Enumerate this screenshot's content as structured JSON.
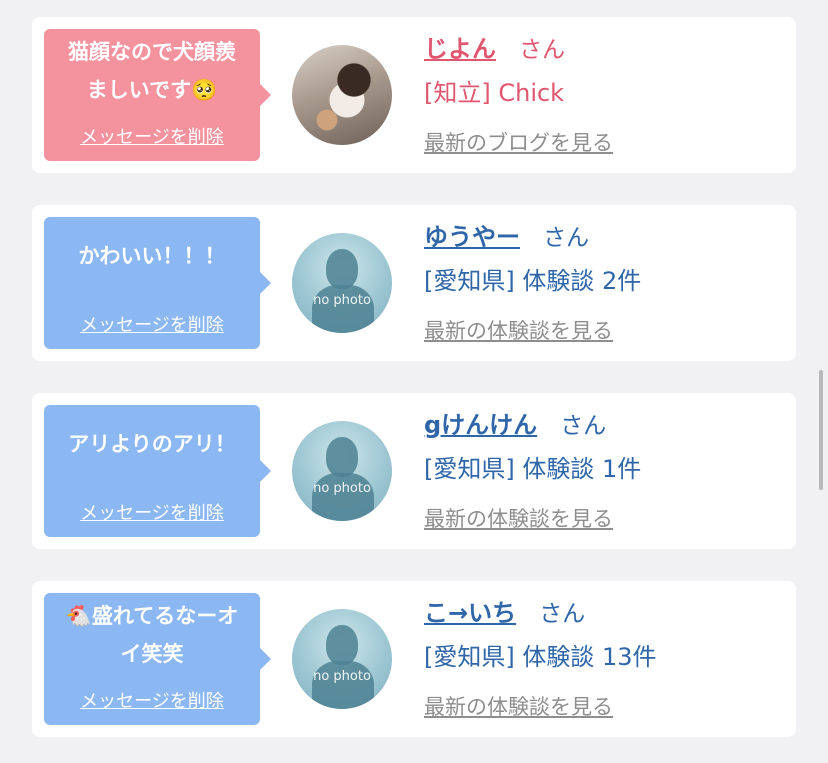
{
  "entries": [
    {
      "message_lines": [
        "猫顔なので犬顔羨",
        "ましいです🥺"
      ],
      "delete_label": "メッセージを削除",
      "name": "じよん",
      "honorific": "さん",
      "meta": "[知立] Chick",
      "link_label": "最新のブログを見る",
      "avatar": "photo",
      "theme": "pink"
    },
    {
      "message_lines": [
        "かわいい！！！"
      ],
      "delete_label": "メッセージを削除",
      "name": "ゆうやー",
      "honorific": "さん",
      "meta": "[愛知県] 体験談 2件",
      "link_label": "最新の体験談を見る",
      "avatar": "no photo",
      "theme": "blue"
    },
    {
      "message_lines": [
        "アリよりのアリ！"
      ],
      "delete_label": "メッセージを削除",
      "name": "gけんけん",
      "honorific": "さん",
      "meta": "[愛知県] 体験談 1件",
      "link_label": "最新の体験談を見る",
      "avatar": "no photo",
      "theme": "blue"
    },
    {
      "message_lines": [
        "🐔盛れてるなーオ",
        "イ笑笑"
      ],
      "delete_label": "メッセージを削除",
      "name": "こ→いち",
      "honorific": "さん",
      "meta": "[愛知県] 体験談 13件",
      "link_label": "最新の体験談を見る",
      "avatar": "no photo",
      "theme": "blue"
    }
  ],
  "colors": {
    "pink_bubble": "#f4929e",
    "blue_bubble": "#8bb7f2",
    "pink_text": "#e0566f",
    "blue_text": "#2f66a8",
    "link_gray": "#8e8e8e"
  }
}
